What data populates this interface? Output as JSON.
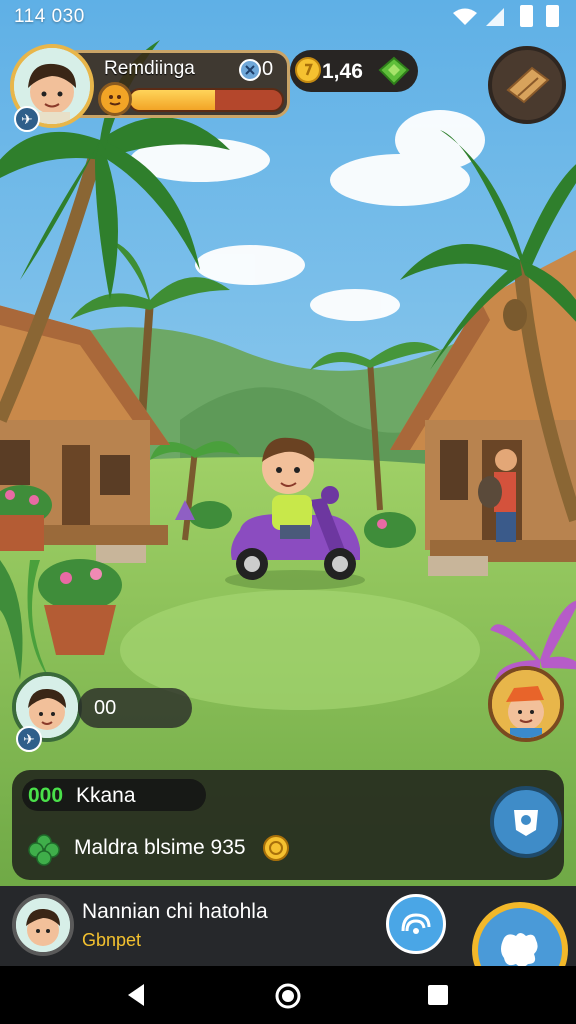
{
  "status_bar": {
    "time": "114 030"
  },
  "hud": {
    "player_name": "Remdiinga",
    "level": "0",
    "xp_progress": 0.56,
    "coins": "1,46"
  },
  "chat": {
    "text": "00"
  },
  "quest": {
    "count": "000",
    "title": "Kkana",
    "description": "Maldra blsime 935"
  },
  "bottom": {
    "player_name": "Nannian chi hatohla",
    "player_subtitle": "Gbnpet"
  },
  "icons": {
    "map": "map-icon",
    "clover": "clover-icon",
    "coin": "coin-icon",
    "gem": "gem-icon",
    "chat": "chat-icon",
    "action": "action-icon"
  },
  "colors": {
    "sky": "#7cc0e8",
    "grass": "#8dc45a",
    "accent_gold": "#e8b64a",
    "quest_green": "#4ae04a",
    "subtitle_yellow": "#f3c12f"
  }
}
